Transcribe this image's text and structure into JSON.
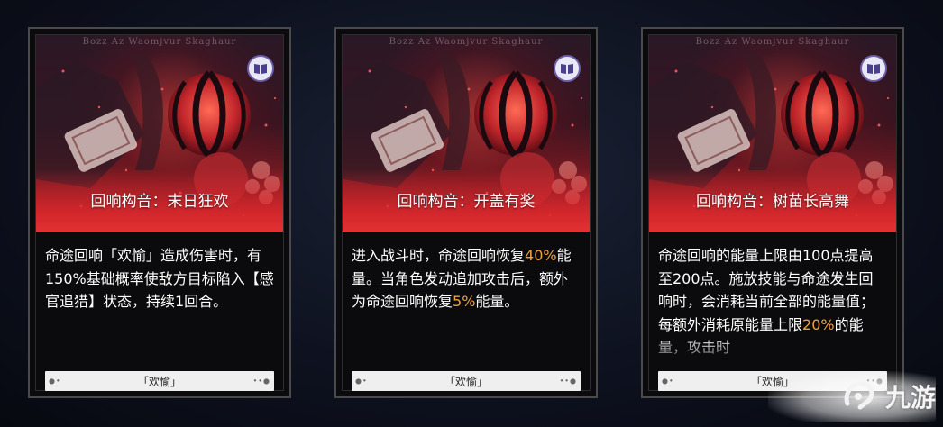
{
  "cards": [
    {
      "art_strip": "Bozz Az Waomjvur Skaghaur",
      "title": "回响构音：末日狂欢",
      "desc": [
        {
          "text": "命途回响「欢愉」造成伤害时，有150%基础概率使敌方目标陷入【感官追猎】状态，持续1回合。",
          "hl": false
        }
      ],
      "tag": "「欢愉」",
      "tag_dots_left": "●•",
      "tag_dots_right": "••●"
    },
    {
      "art_strip": "Bozz Az Waomjvur Skaghaur",
      "title": "回响构音：开盖有奖",
      "desc": [
        {
          "text": "进入战斗时，命途回响恢复",
          "hl": false
        },
        {
          "text": "40%",
          "hl": true
        },
        {
          "text": "能量。当角色发动追加攻击后，额外为命途回响恢复",
          "hl": false
        },
        {
          "text": "5%",
          "hl": true
        },
        {
          "text": "能量。",
          "hl": false
        }
      ],
      "tag": "「欢愉」",
      "tag_dots_left": "●•",
      "tag_dots_right": "••●"
    },
    {
      "art_strip": "Bozz Az Waomjvur Skaghaur",
      "title": "回响构音：树苗长高舞",
      "desc": [
        {
          "text": "命途回响的能量上限由100点提高至200点。施放技能与命途发生回响时，会消耗当前全部的能量值；每额外消耗原能量上限",
          "hl": false
        },
        {
          "text": "20%",
          "hl": true
        },
        {
          "text": "的能量，攻击时",
          "hl": false
        }
      ],
      "tag": "「欢愉」",
      "tag_dots_left": "●•",
      "tag_dots_right": "••●"
    }
  ],
  "watermark": {
    "brand": "九游",
    "icon": "nine-game-logo-icon"
  },
  "colors": {
    "highlight": "#f0a23a",
    "art_red": "#a01f26",
    "book_border": "#6c5fa8"
  }
}
